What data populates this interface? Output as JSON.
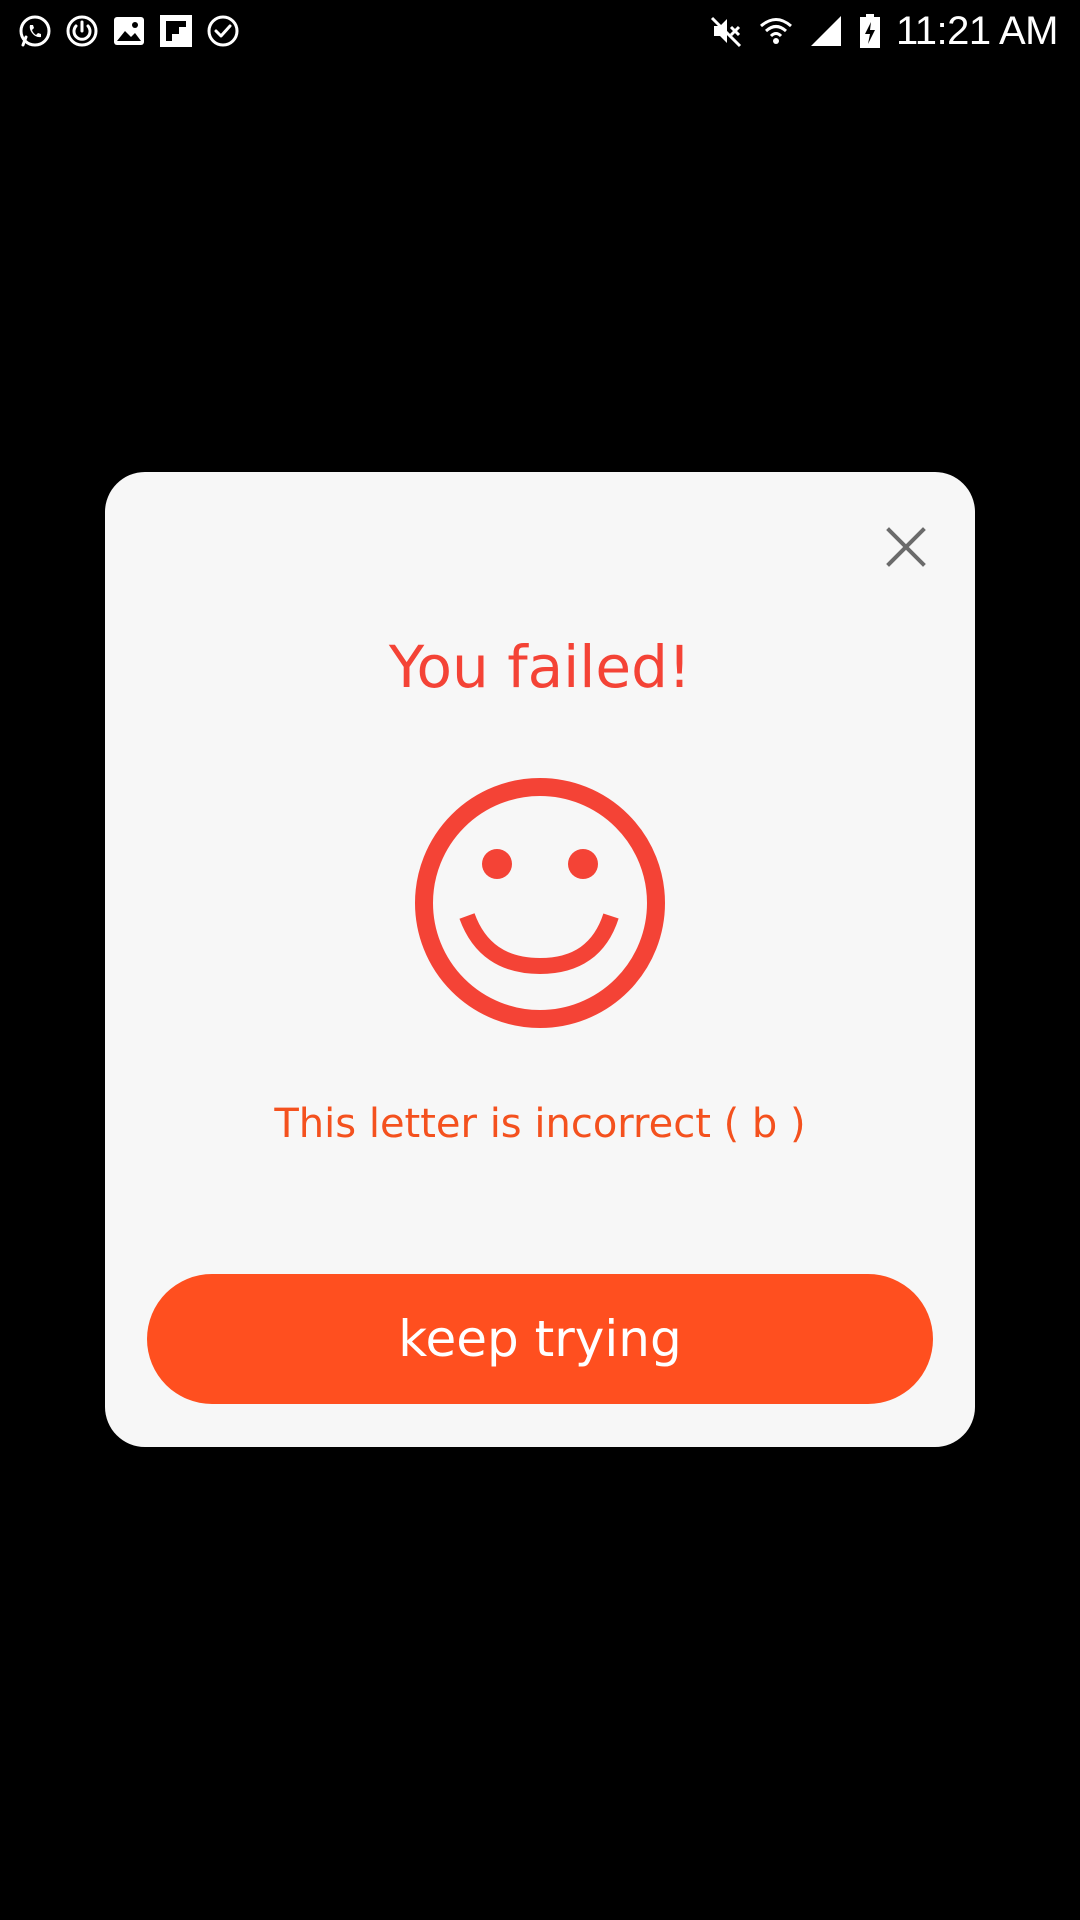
{
  "status_bar": {
    "time": "11:21 AM",
    "left_icons": [
      "whatsapp-icon",
      "sync-icon",
      "image-icon",
      "flipboard-icon",
      "check-circle-icon"
    ],
    "right_icons": [
      "mute-icon",
      "wifi-icon",
      "signal-icon",
      "battery-charging-icon"
    ]
  },
  "dialog": {
    "close_icon": "close-icon",
    "title": "You failed!",
    "face_icon": "smiley-face-icon",
    "message": "This letter is incorrect ( b )",
    "button_label": "keep trying"
  },
  "colors": {
    "background": "#000000",
    "dialog_bg": "#f7f7f7",
    "title": "#f44336",
    "message": "#f4511e",
    "button_bg": "#ff4f1f",
    "button_text": "#ffffff",
    "close_icon": "#6b6b6b"
  }
}
